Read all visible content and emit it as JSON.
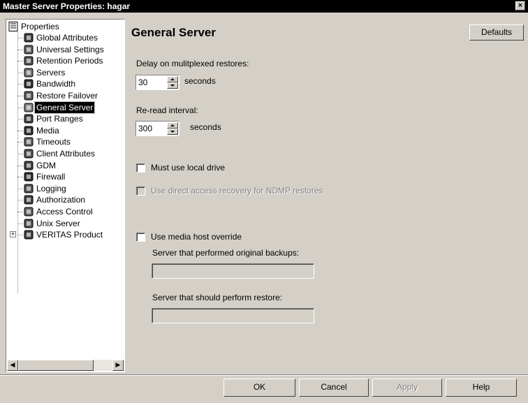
{
  "window": {
    "title": "Master Server Properties: hagar",
    "close_label": "×"
  },
  "tree": {
    "root": "Properties",
    "items": [
      {
        "label": "Global Attributes",
        "icon": "globe-icon"
      },
      {
        "label": "Universal Settings",
        "icon": "universal-settings-icon"
      },
      {
        "label": "Retention Periods",
        "icon": "retention-icon"
      },
      {
        "label": "Servers",
        "icon": "server-icon"
      },
      {
        "label": "Bandwidth",
        "icon": "bandwidth-icon"
      },
      {
        "label": "Restore Failover",
        "icon": "restore-failover-icon"
      },
      {
        "label": "General Server",
        "icon": "general-server-icon"
      },
      {
        "label": "Port Ranges",
        "icon": "port-ranges-icon"
      },
      {
        "label": "Media",
        "icon": "media-icon"
      },
      {
        "label": "Timeouts",
        "icon": "clock-icon"
      },
      {
        "label": "Client Attributes",
        "icon": "client-attributes-icon"
      },
      {
        "label": "GDM",
        "icon": "gdm-icon"
      },
      {
        "label": "Firewall",
        "icon": "firewall-icon"
      },
      {
        "label": "Logging",
        "icon": "logging-icon"
      },
      {
        "label": "Authorization",
        "icon": "authorization-icon"
      },
      {
        "label": "Access Control",
        "icon": "access-control-icon"
      },
      {
        "label": "Unix Server",
        "icon": "unix-server-icon"
      },
      {
        "label": "VERITAS Product",
        "icon": "veritas-product-icon"
      }
    ],
    "selected": "General Server",
    "expand_symbol": "+"
  },
  "panel": {
    "heading": "General Server",
    "defaults_button": "Defaults",
    "delay_label": "Delay on mulitplexed restores:",
    "delay_value": "30",
    "delay_unit": "seconds",
    "reread_label": "Re-read interval:",
    "reread_value": "300",
    "reread_unit": "seconds",
    "must_use_local_drive": {
      "label": "Must use local drive",
      "checked": false
    },
    "direct_access_recovery": {
      "label": "Use direct access recovery for NDMP restores",
      "checked": false,
      "enabled": false
    },
    "media_host_override": {
      "label": "Use media host override",
      "checked": false
    },
    "original_server_label": "Server that performed original backups:",
    "original_server_value": "",
    "restore_server_label": "Server that should perform restore:",
    "restore_server_value": ""
  },
  "buttons": {
    "ok": "OK",
    "cancel": "Cancel",
    "apply": "Apply",
    "help": "Help"
  },
  "colors": {
    "titlebar": "#000000",
    "face": "#d4d0c8",
    "selection": "#000000"
  }
}
